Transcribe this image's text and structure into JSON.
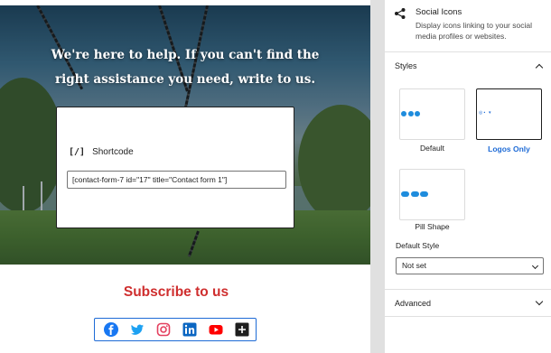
{
  "hero": {
    "heading_line1": "We're here to help. If you can't find the",
    "heading_line2": "right assistance you need, write to us."
  },
  "shortcode": {
    "icon": "[/]",
    "label": "Shortcode",
    "value": "[contact-form-7 id=\"17\" title=\"Contact form 1\"]"
  },
  "subscribe": {
    "title": "Subscribe to us"
  },
  "social_icons": [
    {
      "name": "facebook-icon",
      "color": "#1877f2"
    },
    {
      "name": "twitter-icon",
      "color": "#1da1f2"
    },
    {
      "name": "instagram-icon",
      "color": "#e4405f"
    },
    {
      "name": "linkedin-icon",
      "color": "#0a66c2"
    },
    {
      "name": "youtube-icon",
      "color": "#ff0000"
    },
    {
      "name": "add-icon",
      "color": "#1e1e1e"
    }
  ],
  "sidebar": {
    "block": {
      "icon": "share-icon",
      "title": "Social Icons",
      "description": "Display icons linking to your social media profiles or websites."
    },
    "styles": {
      "heading": "Styles",
      "options": [
        {
          "label": "Default",
          "selected": false
        },
        {
          "label": "Logos Only",
          "selected": true
        },
        {
          "label": "Pill Shape",
          "selected": false
        }
      ],
      "default_style_label": "Default Style",
      "default_style_value": "Not set"
    },
    "advanced": {
      "heading": "Advanced"
    }
  },
  "colors": {
    "accent": "#1e6bd6",
    "subscribe": "#cf2e2e"
  }
}
